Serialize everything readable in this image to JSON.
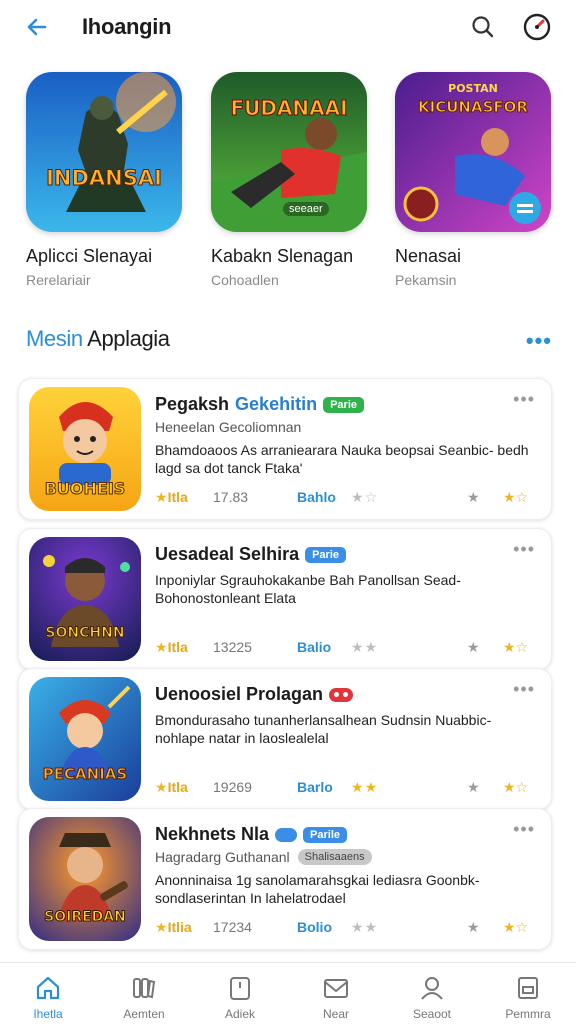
{
  "header": {
    "title": "Ihoangin",
    "back_icon": "back-arrow-icon",
    "search_icon": "search-icon",
    "compass_icon": "compass-icon",
    "accent_color": "#2a8fd8"
  },
  "featured": [
    {
      "name": "Aplicci Slenayai",
      "subtitle": "Rerelariair",
      "art_text": "INDANSAI",
      "colors": [
        "#1b6fd1",
        "#35b6e8"
      ]
    },
    {
      "name": "Kabakn Slenagan",
      "subtitle": "Cohoadlen",
      "art_text": "FUDANAAI",
      "art_subtext": "seeaer",
      "colors": [
        "#1f6a2c",
        "#57b33a"
      ]
    },
    {
      "name": "Nenasai",
      "subtitle": "Pekamsin",
      "art_text": "KICUNASFOR",
      "art_topline": "POSTAN",
      "colors": [
        "#5a1e9b",
        "#c03dc9"
      ]
    }
  ],
  "section": {
    "title_accent": "Mesin",
    "title_rest": " Applagia",
    "more_icon": "more-horizontal-icon"
  },
  "apps": [
    {
      "name_a": "Pegaksh",
      "name_b": "Gekehitin",
      "badge": "Parie",
      "badge_color": "green",
      "developer": "Heneelan Gecoliomnan",
      "description": "Bhamdoaoos As arraniearara Nauka beopsai Seanbic- bedh lagd sa dot tanck Ftaka'",
      "tag": "Itla",
      "count": "17.83",
      "link": "Bahlo",
      "rating_a": "2",
      "rating_b": "2.5",
      "art_text": "BUOHEIS"
    },
    {
      "name_a": "Uesadeal Selhira",
      "name_b": "",
      "badge": "Parie",
      "badge_color": "blue",
      "developer": "",
      "description": "Inponiylar Sgrauhokakanbe Bah Panollsan Sead- Bohonostonleant Elata",
      "tag": "Itla",
      "count": "13225",
      "link": "Balio",
      "rating_a": "2",
      "rating_b": "2.5",
      "art_text": "SONCHNN"
    },
    {
      "name_a": "Uenoosiel Prolagan",
      "name_b": "",
      "badge": "",
      "badge_color": "red",
      "developer": "",
      "description": "Bmondurasaho tunanherlansalhean Sudnsin Nuabbic- nohlape natar in laoslealelal",
      "tag": "Itla",
      "count": "19269",
      "link": "Barlo",
      "rating_a": "2",
      "rating_b": "2.5",
      "art_text": "PECANIAS"
    },
    {
      "name_a": "Nekhnets Nla",
      "name_b": "",
      "badge": "Parile",
      "badge_color": "blue",
      "developer": "Hagradarg Guthananl",
      "developer_tag": "Shalisaaens",
      "description": "Anonninaisa 1g sanolamarahsgkai lediasra Goonbk- sondlaserintan In lahelatrodael",
      "tag": "Itlia",
      "count": "17234",
      "link": "Bolio",
      "rating_a": "2",
      "rating_b": "2.5",
      "art_text": "SOIREDAN"
    }
  ],
  "bottom_nav": [
    {
      "label": "Ihetla",
      "icon": "home-icon",
      "active": true
    },
    {
      "label": "Aemten",
      "icon": "library-icon",
      "active": false
    },
    {
      "label": "Adiek",
      "icon": "tablet-icon",
      "active": false
    },
    {
      "label": "Near",
      "icon": "mail-icon",
      "active": false
    },
    {
      "label": "Seaoot",
      "icon": "person-icon",
      "active": false
    },
    {
      "label": "Pemmra",
      "icon": "settings-box-icon",
      "active": false
    }
  ]
}
